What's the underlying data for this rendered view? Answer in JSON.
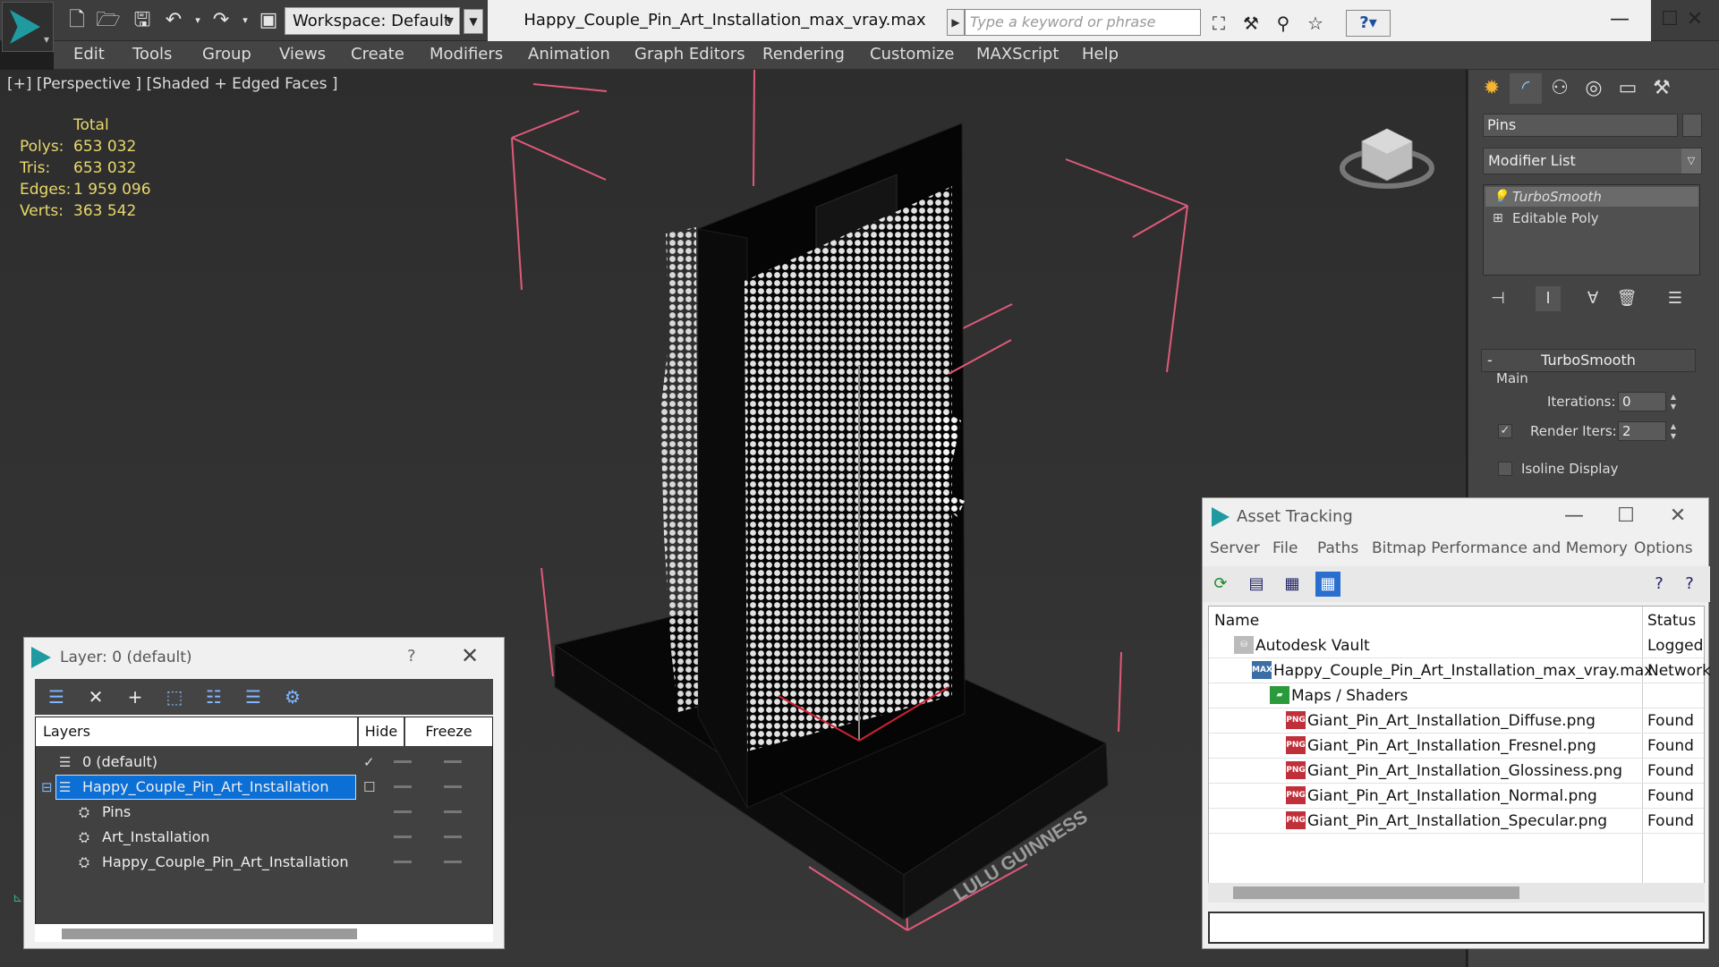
{
  "app": {
    "window_title": "Happy_Couple_Pin_Art_Installation_max_vray.max",
    "workspace": "Workspace: Default",
    "search_placeholder": "Type a keyword or phrase"
  },
  "menu": [
    "Edit",
    "Tools",
    "Group",
    "Views",
    "Create",
    "Modifiers",
    "Animation",
    "Graph Editors",
    "Rendering",
    "Customize",
    "MAXScript",
    "Help"
  ],
  "viewport": {
    "label": "[+] [Perspective ] [Shaded + Edged Faces ]",
    "stats": {
      "header": "Total",
      "rows": [
        {
          "label": "Polys:",
          "value": "653 032"
        },
        {
          "label": "Tris:",
          "value": "653 032"
        },
        {
          "label": "Edges:",
          "value": "1 959 096"
        },
        {
          "label": "Verts:",
          "value": "363 542"
        }
      ]
    },
    "base_text": "LULU GUINNESS"
  },
  "command_panel": {
    "object_name": "Pins",
    "modifier_list": "Modifier List",
    "stack": [
      "TurboSmooth",
      "Editable Poly"
    ],
    "rollout_title": "TurboSmooth",
    "group_main": "Main",
    "iterations_label": "Iterations:",
    "iterations_value": "0",
    "render_iters_label": "Render Iters:",
    "render_iters_value": "2",
    "isoline_label": "Isoline Display"
  },
  "layer_dialog": {
    "title": "Layer: 0 (default)",
    "help": "?",
    "columns": {
      "layers": "Layers",
      "hide": "Hide",
      "freeze": "Freeze"
    },
    "rows": [
      {
        "name": "0 (default)"
      },
      {
        "name": "Happy_Couple_Pin_Art_Installation"
      },
      {
        "name": "Pins"
      },
      {
        "name": "Art_Installation"
      },
      {
        "name": "Happy_Couple_Pin_Art_Installation"
      }
    ]
  },
  "asset_tracking": {
    "title": "Asset Tracking",
    "menu": [
      "Server",
      "File",
      "Paths",
      "Bitmap Performance and Memory",
      "Options"
    ],
    "columns": {
      "name": "Name",
      "status": "Status"
    },
    "rows": [
      {
        "name": "Autodesk Vault",
        "status": "Logged",
        "icon": "vault-icon"
      },
      {
        "name": "Happy_Couple_Pin_Art_Installation_max_vray.max",
        "status": "Network",
        "icon": "max-file-icon"
      },
      {
        "name": "Maps / Shaders",
        "status": "",
        "icon": "maps-folder-icon"
      },
      {
        "name": "Giant_Pin_Art_Installation_Diffuse.png",
        "status": "Found",
        "icon": "png-icon"
      },
      {
        "name": "Giant_Pin_Art_Installation_Fresnel.png",
        "status": "Found",
        "icon": "png-icon"
      },
      {
        "name": "Giant_Pin_Art_Installation_Glossiness.png",
        "status": "Found",
        "icon": "png-icon"
      },
      {
        "name": "Giant_Pin_Art_Installation_Normal.png",
        "status": "Found",
        "icon": "png-icon"
      },
      {
        "name": "Giant_Pin_Art_Installation_Specular.png",
        "status": "Found",
        "icon": "png-icon"
      }
    ]
  },
  "colors": {
    "accent": "#1f9ba0",
    "stats": "#e8d86a",
    "selection": "#0b6fd6",
    "bbox": "#e05a7a"
  }
}
